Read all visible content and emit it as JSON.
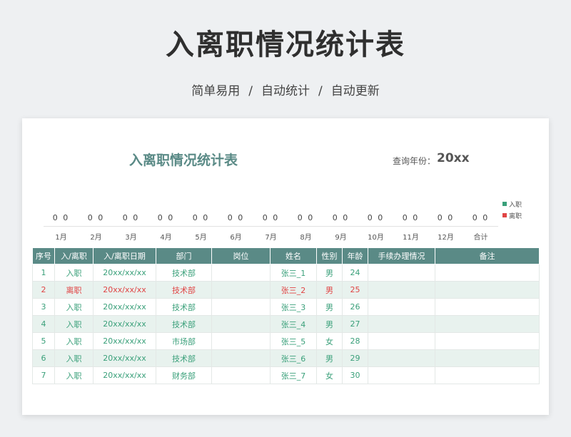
{
  "hero": {
    "title": "入离职情况统计表",
    "tags": [
      "简单易用",
      "自动统计",
      "自动更新"
    ],
    "separator": "/"
  },
  "sheet": {
    "title": "入离职情况统计表",
    "query_label": "查询年份：",
    "query_year": "20xx"
  },
  "legend": [
    {
      "label": "入职",
      "color": "#3aa07a"
    },
    {
      "label": "离职",
      "color": "#e04444"
    }
  ],
  "summary": [
    {
      "month": "1月",
      "vals": "0 0"
    },
    {
      "month": "2月",
      "vals": "0 0"
    },
    {
      "month": "3月",
      "vals": "0 0"
    },
    {
      "month": "4月",
      "vals": "0 0"
    },
    {
      "month": "5月",
      "vals": "0 0"
    },
    {
      "month": "6月",
      "vals": "0 0"
    },
    {
      "month": "7月",
      "vals": "0 0"
    },
    {
      "month": "8月",
      "vals": "0 0"
    },
    {
      "month": "9月",
      "vals": "0 0"
    },
    {
      "month": "10月",
      "vals": "0 0"
    },
    {
      "month": "11月",
      "vals": "0 0"
    },
    {
      "month": "12月",
      "vals": "0 0"
    },
    {
      "month": "合计",
      "vals": "0 0"
    }
  ],
  "table": {
    "headers": [
      "序号",
      "入/离职",
      "入/离职日期",
      "部门",
      "岗位",
      "姓名",
      "性别",
      "年龄",
      "手续办理情况",
      "备注"
    ],
    "rows": [
      {
        "no": "1",
        "type": "入职",
        "date": "20xx/xx/xx",
        "dept": "技术部",
        "post": "",
        "name": "张三_1",
        "gender": "男",
        "age": "24",
        "proc": "",
        "note": "",
        "leave": false
      },
      {
        "no": "2",
        "type": "离职",
        "date": "20xx/xx/xx",
        "dept": "技术部",
        "post": "",
        "name": "张三_2",
        "gender": "男",
        "age": "25",
        "proc": "",
        "note": "",
        "leave": true
      },
      {
        "no": "3",
        "type": "入职",
        "date": "20xx/xx/xx",
        "dept": "技术部",
        "post": "",
        "name": "张三_3",
        "gender": "男",
        "age": "26",
        "proc": "",
        "note": "",
        "leave": false
      },
      {
        "no": "4",
        "type": "入职",
        "date": "20xx/xx/xx",
        "dept": "技术部",
        "post": "",
        "name": "张三_4",
        "gender": "男",
        "age": "27",
        "proc": "",
        "note": "",
        "leave": false
      },
      {
        "no": "5",
        "type": "入职",
        "date": "20xx/xx/xx",
        "dept": "市场部",
        "post": "",
        "name": "张三_5",
        "gender": "女",
        "age": "28",
        "proc": "",
        "note": "",
        "leave": false
      },
      {
        "no": "6",
        "type": "入职",
        "date": "20xx/xx/xx",
        "dept": "技术部",
        "post": "",
        "name": "张三_6",
        "gender": "男",
        "age": "29",
        "proc": "",
        "note": "",
        "leave": false
      },
      {
        "no": "7",
        "type": "入职",
        "date": "20xx/xx/xx",
        "dept": "财务部",
        "post": "",
        "name": "张三_7",
        "gender": "女",
        "age": "30",
        "proc": "",
        "note": "",
        "leave": false
      }
    ]
  }
}
